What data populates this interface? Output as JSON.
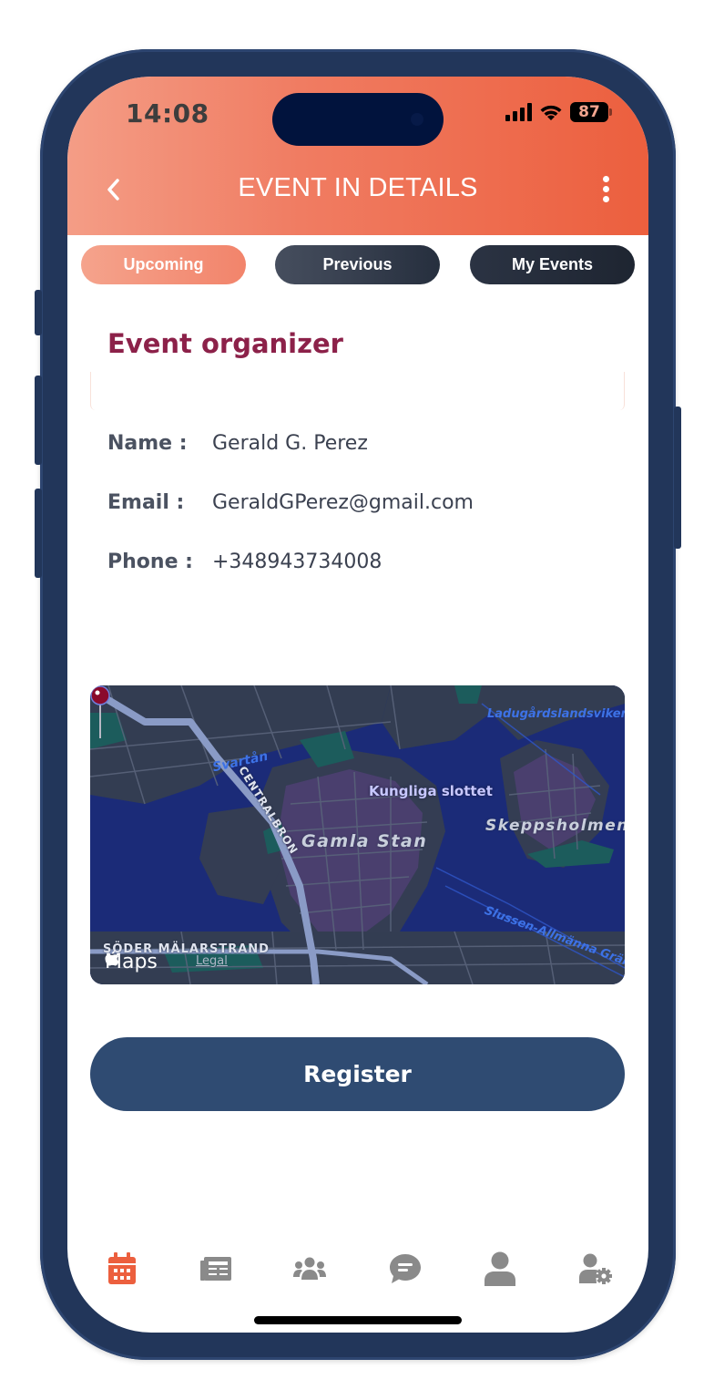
{
  "status_bar": {
    "time": "14:08",
    "battery_percent": "87"
  },
  "header": {
    "title": "EVENT IN DETAILS",
    "back_icon": "chevron-left-icon",
    "more_icon": "vertical-dots-icon"
  },
  "tabs": [
    {
      "label": "Upcoming",
      "active": true
    },
    {
      "label": "Previous",
      "active": false
    },
    {
      "label": "My Events",
      "active": false
    }
  ],
  "organizer": {
    "section_title": "Event organizer",
    "fields": [
      {
        "label": "Name :",
        "value": "Gerald G. Perez"
      },
      {
        "label": "Email :",
        "value": "GeraldGPerez@gmail.com"
      },
      {
        "label": "Phone :",
        "value": "+348943734008"
      }
    ]
  },
  "map": {
    "pin_label": "Kungliga slottet",
    "labels": {
      "area_main": "Gamla Stan",
      "area_east": "Skeppsholmen",
      "water_north": "Ladugårdslandsviken",
      "water_west": "Svartån",
      "water_southeast": "Slussen-Allmänna Gränd",
      "road_bridge": "CENTRALBRON",
      "road_south": "SÖDER MÄLARSTRAND"
    },
    "attribution": "Maps",
    "legal": "Legal"
  },
  "actions": {
    "register_label": "Register"
  },
  "bottom_nav": [
    {
      "icon": "calendar-icon",
      "active": true
    },
    {
      "icon": "newspaper-icon",
      "active": false
    },
    {
      "icon": "users-group-icon",
      "active": false
    },
    {
      "icon": "chat-bubble-icon",
      "active": false
    },
    {
      "icon": "user-icon",
      "active": false
    },
    {
      "icon": "user-settings-icon",
      "active": false
    }
  ],
  "colors": {
    "header_gradient_start": "#f49d86",
    "header_gradient_end": "#ec5f3e",
    "accent": "#ec5f3e",
    "section_title": "#8c2149",
    "register_button": "#2f4b72",
    "phone_frame": "#22365a",
    "nav_inactive": "#8a8a8a"
  }
}
